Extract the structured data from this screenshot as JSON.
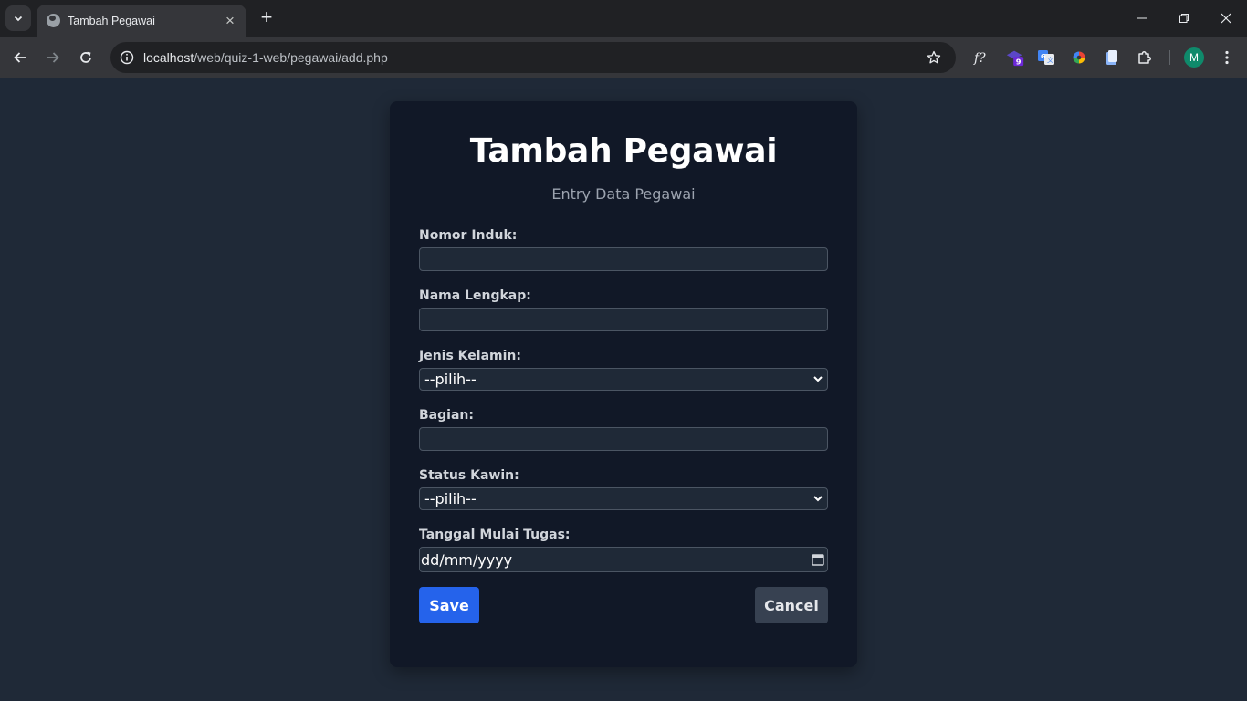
{
  "browser": {
    "tab_title": "Tambah Pegawai",
    "url_host": "localhost",
    "url_path": "/web/quiz-1-web/pegawai/add.php",
    "extension_badge": "9",
    "profile_initial": "M",
    "accent_color": "#0f8a6b"
  },
  "page": {
    "title": "Tambah Pegawai",
    "subtitle": "Entry Data Pegawai",
    "fields": {
      "nomor_induk": {
        "label": "Nomor Induk:",
        "value": ""
      },
      "nama_lengkap": {
        "label": "Nama Lengkap:",
        "value": ""
      },
      "jenis_kelamin": {
        "label": "Jenis Kelamin:",
        "selected": "--pilih--"
      },
      "bagian": {
        "label": "Bagian:",
        "value": ""
      },
      "status_kawin": {
        "label": "Status Kawin:",
        "selected": "--pilih--"
      },
      "tanggal_mulai": {
        "label": "Tanggal Mulai Tugas:",
        "placeholder": "dd/mm/yyyy"
      }
    },
    "buttons": {
      "save": "Save",
      "cancel": "Cancel"
    },
    "colors": {
      "primary": "#2563eb",
      "secondary": "#374151",
      "card_bg": "#111827",
      "page_bg": "#1f2937"
    }
  }
}
